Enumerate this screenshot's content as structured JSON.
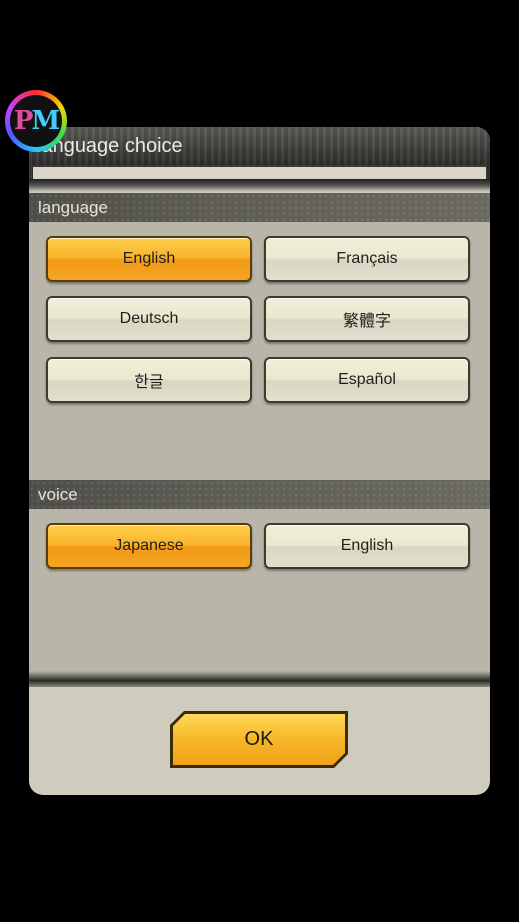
{
  "logo": {
    "text_p": "P",
    "text_m": "M"
  },
  "dialog": {
    "title": "language choice",
    "language_section": {
      "label": "language",
      "options": [
        "English",
        "Français",
        "Deutsch",
        "繁體字",
        "한글",
        "Español"
      ],
      "selected": "English"
    },
    "voice_section": {
      "label": "voice",
      "options": [
        "Japanese",
        "English"
      ],
      "selected": "Japanese"
    },
    "ok_label": "OK"
  },
  "colors": {
    "selected": "#f6b626",
    "unselected": "#ebe8cf",
    "dialog_bg": "#cfccbd"
  }
}
